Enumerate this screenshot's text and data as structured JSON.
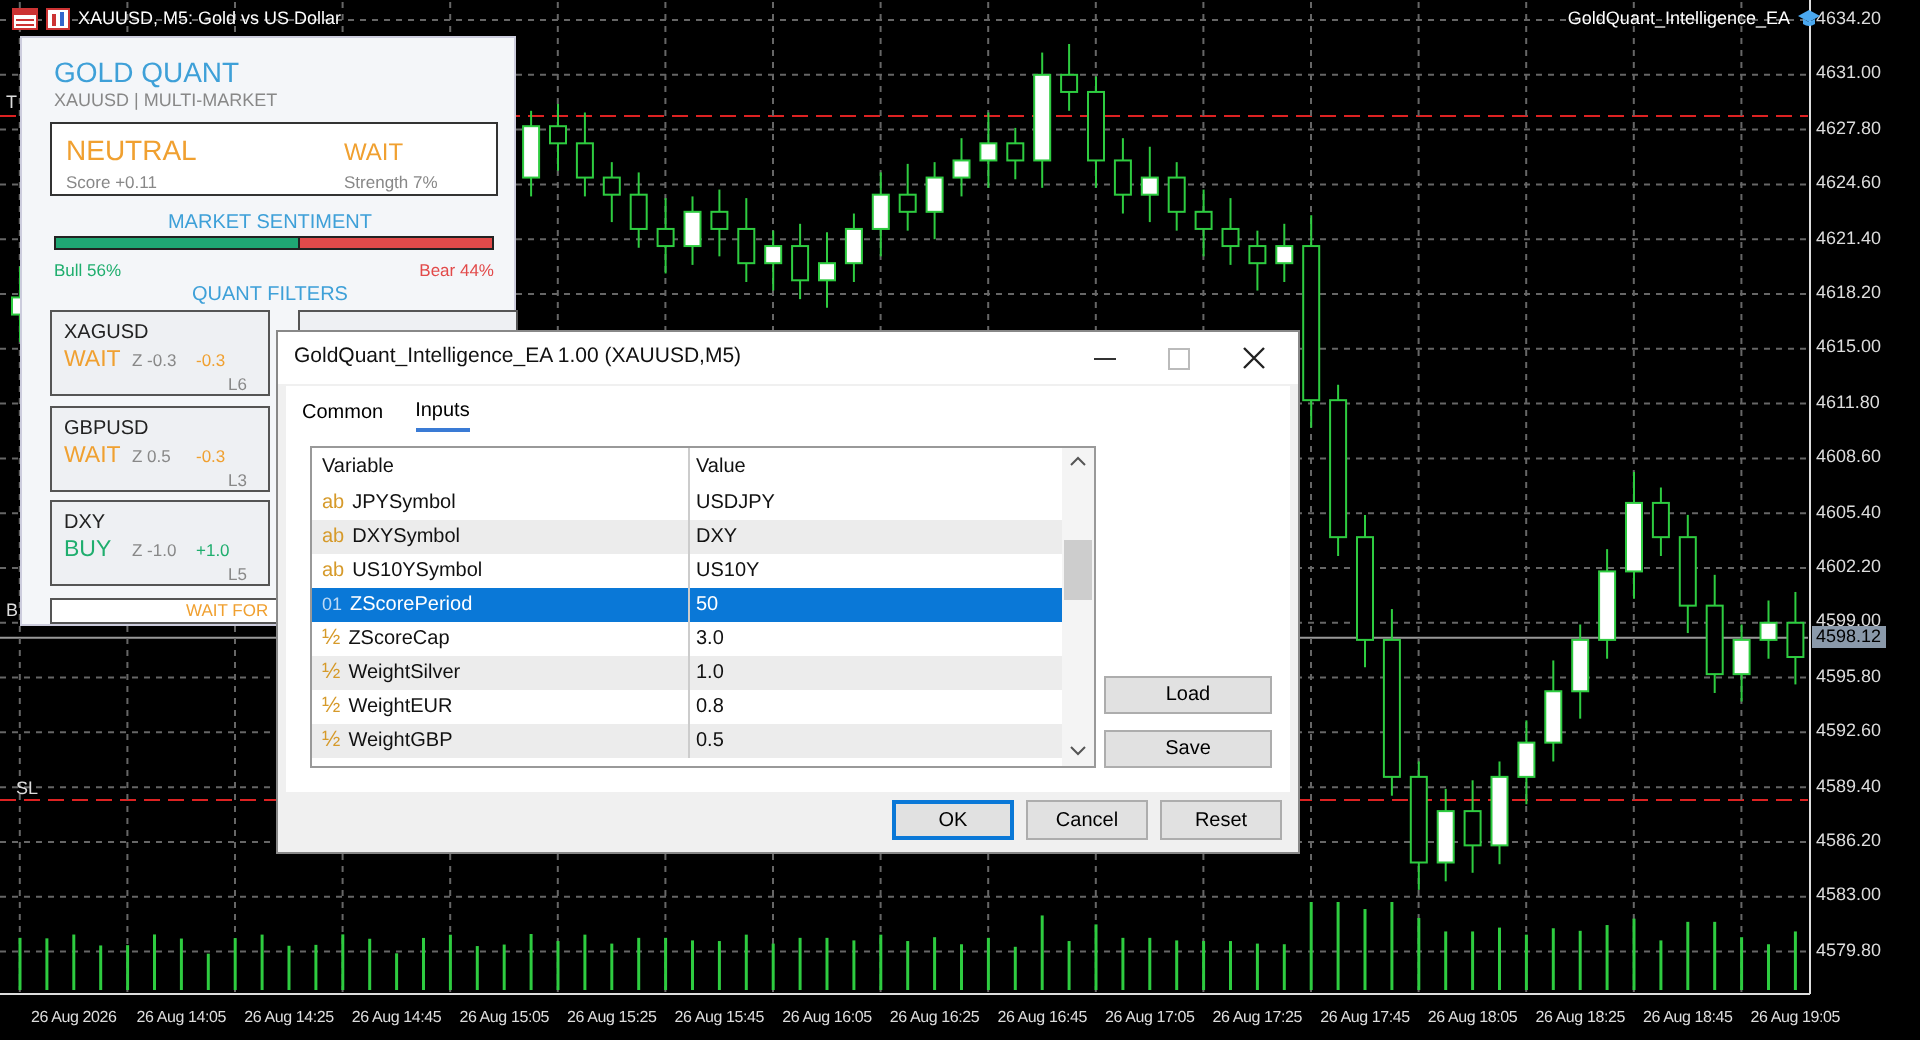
{
  "chart": {
    "title": "XAUUSD, M5: Gold vs US Dollar",
    "expert_name": "GoldQuant_Intelligence_EA",
    "chart_data": {
      "type": "candlestick",
      "categories": [
        null,
        null,
        "26 Aug 2026",
        null,
        null,
        null,
        "26 Aug 14:05",
        null,
        null,
        null,
        "26 Aug 14:25",
        null,
        null,
        null,
        "26 Aug 14:45",
        null,
        null,
        null,
        "26 Aug 15:05",
        null,
        null,
        null,
        "26 Aug 15:25",
        null,
        null,
        null,
        "26 Aug 15:45",
        null,
        null,
        null,
        "26 Aug 16:05",
        null,
        null,
        null,
        "26 Aug 16:25",
        null,
        null,
        null,
        "26 Aug 16:45",
        null,
        null,
        null,
        "26 Aug 17:05",
        null,
        null,
        null,
        "26 Aug 17:25",
        null,
        null,
        null,
        "26 Aug 17:45",
        null,
        null,
        null,
        "26 Aug 18:05",
        null,
        null,
        null,
        "26 Aug 18:25",
        null,
        null,
        null,
        "26 Aug 18:45",
        null,
        null,
        null,
        "26 Aug 19:05"
      ],
      "ohlc": [
        [
          4617,
          4619.8,
          4615.4,
          4618
        ],
        null,
        null,
        null,
        null,
        null,
        null,
        null,
        null,
        null,
        null,
        null,
        null,
        null,
        null,
        null,
        null,
        null,
        null,
        [
          4625,
          4628.9,
          4623.9,
          4628
        ],
        [
          4628,
          4629.3,
          4625.4,
          4627
        ],
        [
          4627,
          4628.8,
          4623.9,
          4625
        ],
        [
          4625,
          4625.9,
          4622.4,
          4624
        ],
        [
          4624,
          4625.3,
          4620.9,
          4622
        ],
        [
          4622,
          4623.8,
          4619.4,
          4621
        ],
        [
          4621,
          4623.9,
          4619.9,
          4623
        ],
        [
          4623,
          4624.3,
          4620.4,
          4622
        ],
        [
          4622,
          4623.8,
          4618.9,
          4620
        ],
        [
          4620,
          4621.9,
          4618.4,
          4621
        ],
        [
          4621,
          4622.3,
          4617.9,
          4619
        ],
        [
          4619,
          4621.8,
          4617.4,
          4620
        ],
        [
          4620,
          4622.9,
          4618.9,
          4622
        ],
        [
          4622,
          4625.3,
          4620.4,
          4624
        ],
        [
          4624,
          4625.8,
          4621.9,
          4623
        ],
        [
          4623,
          4625.9,
          4621.4,
          4625
        ],
        [
          4625,
          4627.3,
          4623.9,
          4626
        ],
        [
          4626,
          4628.8,
          4624.4,
          4627
        ],
        [
          4627,
          4627.9,
          4624.9,
          4626
        ],
        [
          4626,
          4632.3,
          4624.4,
          4631
        ],
        [
          4631,
          4632.8,
          4628.9,
          4630
        ],
        [
          4630,
          4630.9,
          4624.4,
          4626
        ],
        [
          4626,
          4627.3,
          4622.9,
          4624
        ],
        [
          4624,
          4626.8,
          4622.4,
          4625
        ],
        [
          4625,
          4625.9,
          4621.9,
          4623
        ],
        [
          4623,
          4624.3,
          4620.4,
          4622
        ],
        [
          4622,
          4623.8,
          4619.9,
          4621
        ],
        [
          4621,
          4621.9,
          4618.4,
          4620
        ],
        [
          4620,
          4622.3,
          4618.9,
          4621
        ],
        [
          4621,
          4622.8,
          4610.4,
          4612
        ],
        [
          4612,
          4612.9,
          4602.9,
          4604
        ],
        [
          4604,
          4605.3,
          4596.4,
          4598
        ],
        [
          4598,
          4599.8,
          4588.9,
          4590
        ],
        [
          4590,
          4590.9,
          4583.4,
          4585
        ],
        [
          4585,
          4589.3,
          4583.9,
          4588
        ],
        [
          4588,
          4589.8,
          4584.4,
          4586
        ],
        [
          4586,
          4590.9,
          4584.9,
          4590
        ],
        [
          4590,
          4593.3,
          4588.4,
          4592
        ],
        [
          4592,
          4596.8,
          4590.9,
          4595
        ],
        [
          4595,
          4598.9,
          4593.4,
          4598
        ],
        [
          4598,
          4603.3,
          4596.9,
          4602
        ],
        [
          4602,
          4607.8,
          4600.4,
          4606
        ],
        [
          4606,
          4606.9,
          4602.9,
          4604
        ],
        [
          4604,
          4605.3,
          4598.4,
          4600
        ],
        [
          4600,
          4601.8,
          4594.9,
          4596
        ],
        [
          4596,
          4598.9,
          4594.4,
          4598
        ],
        [
          4598,
          4600.3,
          4596.9,
          4599
        ],
        [
          4599,
          4600.8,
          4595.4,
          4597
        ]
      ],
      "ylim": [
        4577.32,
        4635.37
      ],
      "yticks": [
        {
          "value": 4634.2,
          "label": "4634.20"
        },
        {
          "value": 4631.0,
          "label": "4631.00"
        },
        {
          "value": 4627.8,
          "label": "4627.80"
        },
        {
          "value": 4624.6,
          "label": "4624.60"
        },
        {
          "value": 4621.4,
          "label": "4621.40"
        },
        {
          "value": 4618.2,
          "label": "4618.20"
        },
        {
          "value": 4615.0,
          "label": "4615.00"
        },
        {
          "value": 4611.8,
          "label": "4611.80"
        },
        {
          "value": 4608.6,
          "label": "4608.60"
        },
        {
          "value": 4605.4,
          "label": "4605.40"
        },
        {
          "value": 4602.2,
          "label": "4602.20"
        },
        {
          "value": 4599.0,
          "label": "4599.00"
        },
        {
          "value": 4595.8,
          "label": "4595.80"
        },
        {
          "value": 4592.6,
          "label": "4592.60"
        },
        {
          "value": 4589.4,
          "label": "4589.40"
        },
        {
          "value": 4586.2,
          "label": "4586.20"
        },
        {
          "value": 4583.0,
          "label": "4583.00"
        },
        {
          "value": 4579.8,
          "label": "4579.80"
        }
      ],
      "grid": true
    },
    "current_price": "4598.12",
    "line_labels": [
      {
        "text": "T",
        "kind": "top"
      },
      {
        "text": "B",
        "kind": "bottom"
      },
      {
        "text": "SL",
        "kind": "stop"
      }
    ]
  },
  "panel": {
    "title": "GOLD QUANT",
    "subtitle": "XAUUSD | MULTI-MARKET",
    "signal": "NEUTRAL",
    "score": "Score +0.11",
    "action": "WAIT",
    "strength": "Strength 7%",
    "sentiment_title": "MARKET SENTIMENT",
    "sentiment_bar": {
      "level": 0.56
    },
    "bull_label": "Bull 56%",
    "bear_label": "Bear 44%",
    "filters_title": "QUANT FILTERS",
    "filters": [
      {
        "symbol": "XAGUSD",
        "signal": "WAIT",
        "kind": "wait",
        "z": "Z -0.3",
        "bias": "-0.3",
        "lag": "L6"
      },
      {
        "symbol": "GBPUSD",
        "signal": "WAIT",
        "kind": "wait",
        "z": "Z 0.5",
        "bias": "-0.3",
        "lag": "L3"
      },
      {
        "symbol": "DXY",
        "signal": "BUY",
        "kind": "buy",
        "z": "Z -1.0",
        "bias": "+1.0",
        "lag": "L5"
      }
    ],
    "footer": "WAIT FOR"
  },
  "dialog": {
    "title": "GoldQuant_Intelligence_EA 1.00 (XAUUSD,M5)",
    "tabs": [
      {
        "label": "Common",
        "selected": false
      },
      {
        "label": "Inputs",
        "selected": true
      }
    ],
    "columns": [
      "Variable",
      "Value"
    ],
    "rows": [
      {
        "kind": "string",
        "icon": "ab",
        "variable": "JPYSymbol",
        "value": "USDJPY",
        "selected": false
      },
      {
        "kind": "string",
        "icon": "ab",
        "variable": "DXYSymbol",
        "value": "DXY",
        "selected": false
      },
      {
        "kind": "string",
        "icon": "ab",
        "variable": "US10YSymbol",
        "value": "US10Y",
        "selected": false
      },
      {
        "kind": "int",
        "icon": "01",
        "variable": "ZScorePeriod",
        "value": "50",
        "selected": true
      },
      {
        "kind": "double",
        "icon": "½",
        "variable": "ZScoreCap",
        "value": "3.0",
        "selected": false
      },
      {
        "kind": "double",
        "icon": "½",
        "variable": "WeightSilver",
        "value": "1.0",
        "selected": false
      },
      {
        "kind": "double",
        "icon": "½",
        "variable": "WeightEUR",
        "value": "0.8",
        "selected": false
      },
      {
        "kind": "double",
        "icon": "½",
        "variable": "WeightGBP",
        "value": "0.5",
        "selected": false
      }
    ],
    "side_buttons": [
      "Load",
      "Save"
    ],
    "buttons": [
      {
        "label": "OK",
        "default": true
      },
      {
        "label": "Cancel",
        "default": false
      },
      {
        "label": "Reset",
        "default": false
      }
    ]
  }
}
